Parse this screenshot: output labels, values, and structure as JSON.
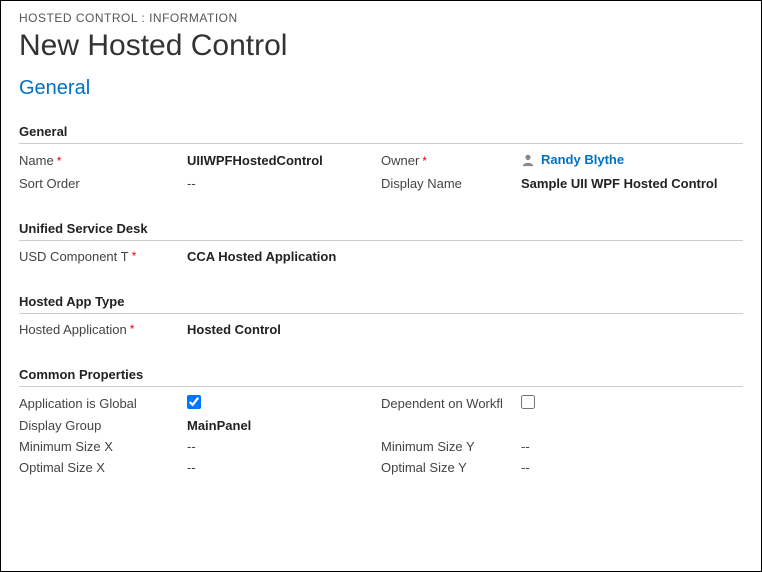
{
  "breadcrumb": "HOSTED CONTROL : INFORMATION",
  "page_title": "New Hosted Control",
  "tab_title": "General",
  "sections": {
    "general": {
      "header": "General",
      "name_label": "Name",
      "name_value": "UIIWPFHostedControl",
      "owner_label": "Owner",
      "owner_value": "Randy Blythe",
      "sort_order_label": "Sort Order",
      "sort_order_value": "--",
      "display_name_label": "Display Name",
      "display_name_value": "Sample UII WPF Hosted Control"
    },
    "usd": {
      "header": "Unified Service Desk",
      "component_label": "USD Component T",
      "component_value": "CCA Hosted Application"
    },
    "hosted_app": {
      "header": "Hosted App Type",
      "hosted_app_label": "Hosted Application",
      "hosted_app_value": "Hosted Control"
    },
    "common": {
      "header": "Common Properties",
      "app_global_label": "Application is Global",
      "dependent_label": "Dependent on Workfl",
      "display_group_label": "Display Group",
      "display_group_value": "MainPanel",
      "min_x_label": "Minimum Size X",
      "min_x_value": "--",
      "min_y_label": "Minimum Size Y",
      "min_y_value": "--",
      "opt_x_label": "Optimal Size X",
      "opt_x_value": "--",
      "opt_y_label": "Optimal Size Y",
      "opt_y_value": "--"
    }
  }
}
